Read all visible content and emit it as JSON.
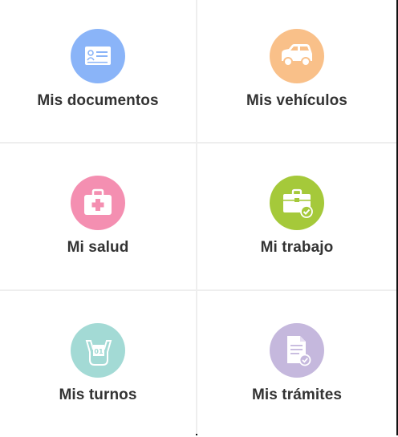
{
  "tiles": [
    {
      "label": "Mis documentos",
      "icon": "id-card-icon",
      "color": "#8ab4f8"
    },
    {
      "label": "Mis vehículos",
      "icon": "car-icon",
      "color": "#f9c089"
    },
    {
      "label": "Mi salud",
      "icon": "medical-kit-icon",
      "color": "#f48fb1"
    },
    {
      "label": "Mi trabajo",
      "icon": "briefcase-check-icon",
      "color": "#a5c93a"
    },
    {
      "label": "Mis turnos",
      "icon": "ticket-hand-icon",
      "color": "#a3dad5"
    },
    {
      "label": "Mis trámites",
      "icon": "document-check-icon",
      "color": "#c5b8dd"
    }
  ]
}
